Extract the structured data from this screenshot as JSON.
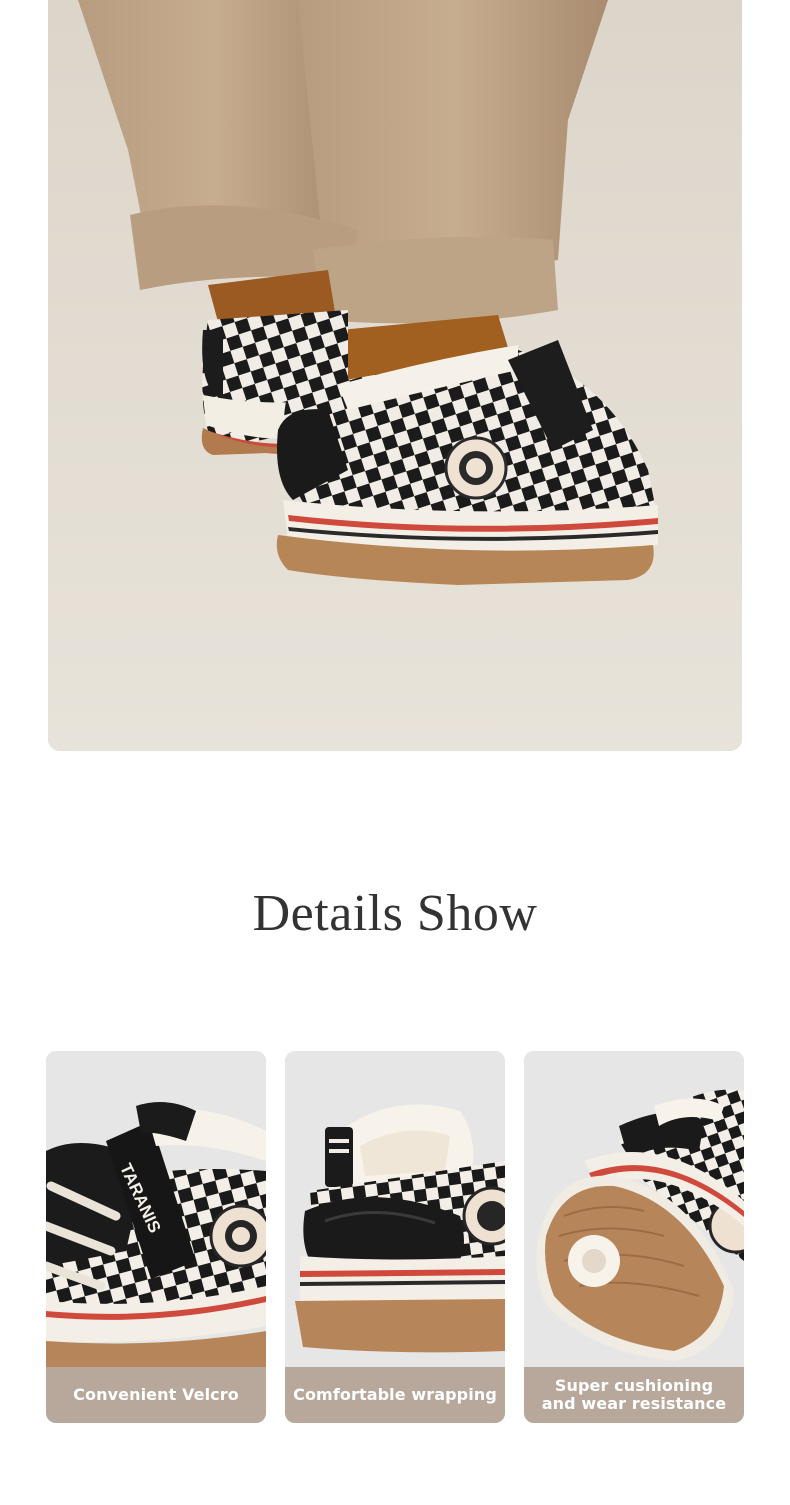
{
  "section": {
    "title": "Details Show"
  },
  "brand_mark": "TARANIS",
  "features": [
    {
      "icon": "velcro-strap",
      "caption": "Convenient Velcro"
    },
    {
      "icon": "plush-collar",
      "caption": "Comfortable wrapping"
    },
    {
      "icon": "rubber-sole",
      "caption_lines": [
        "Super cushioning",
        "and wear resistance"
      ]
    }
  ],
  "colors": {
    "caption_bg": "#b7a89b",
    "title_text": "#333333",
    "hero_bg": "#e3ddd3",
    "card_bg": "#e8e8e8"
  }
}
